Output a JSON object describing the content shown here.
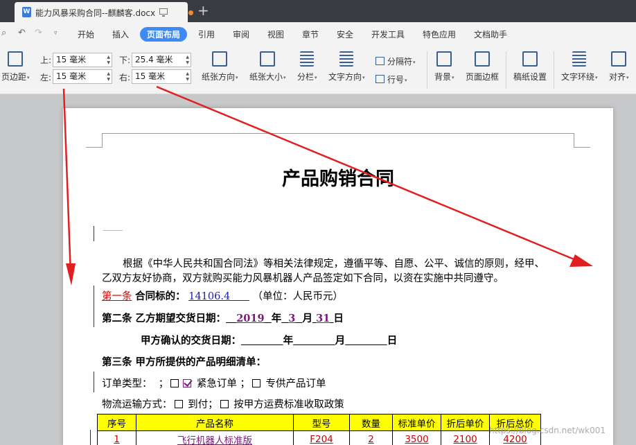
{
  "window": {
    "tab_title": "能力风暴采购合同--麒麟客.docx",
    "doc_icon_label": "W",
    "new_tab_icon": "plus-icon"
  },
  "menu": {
    "icons": [
      "print-preview-icon",
      "undo-icon",
      "redo-icon",
      "dropdown-icon"
    ],
    "items": [
      "开始",
      "插入",
      "页面布局",
      "引用",
      "审阅",
      "视图",
      "章节",
      "安全",
      "开发工具",
      "特色应用",
      "文档助手"
    ],
    "active": "页面布局"
  },
  "ribbon": {
    "margins_button": "页边距",
    "top_label": "上:",
    "top_value": "15 毫米",
    "bottom_label": "下:",
    "bottom_value": "25.4 毫米",
    "left_label": "左:",
    "left_value": "15 毫米",
    "right_label": "右:",
    "right_value": "15 毫米",
    "orientation": "纸张方向",
    "paper_size": "纸张大小",
    "columns": "分栏",
    "text_direction": "文字方向",
    "separator": "分隔符",
    "line_numbers": "行号",
    "background": "背景",
    "page_border": "页面边框",
    "manuscript": "稿纸设置",
    "text_wrap": "文字环绕",
    "align": "对齐"
  },
  "document": {
    "title": "产品购销合同",
    "para1_line1": "根据《中华人民共和国合同法》等相关法律规定，遵循平等、自愿、公平、诚信的原则，经甲、",
    "para1_line2": "乙双方友好协商，双方就购买能力风暴机器人产品签定如下合同，以资在实施中共同遵守。",
    "article1_label": "第一条",
    "article1_text": "合同标的：",
    "article1_amount": "14106.4",
    "article1_unit": "（单位：人民币元）",
    "article2_label": "第二条  乙方期望交货日期：",
    "article2_year": "2019",
    "article2_month": "3",
    "article2_day": "31",
    "year_char": "年",
    "month_char": "月",
    "day_char": "日",
    "confirm_label": "甲方确认的交货日期：",
    "article3": "第三条  甲方所提供的产品明细清单：",
    "order_type_label": "订单类型：",
    "order_type_urgent": "紧急订单",
    "order_type_special": "专供产品订单",
    "logistics_label": "物流运输方式：",
    "logistics_opt1": "到付；",
    "logistics_opt2": "按甲方运费标准收取政策",
    "table": {
      "headers": [
        "序号",
        "产品名称",
        "型号",
        "数量",
        "标准单价",
        "折后单价",
        "折后总价"
      ],
      "rows": [
        [
          "1",
          "飞行机器人标准版",
          "F204",
          "2",
          "3500",
          "2100",
          "4200"
        ]
      ]
    }
  },
  "watermark": "https://blog.csdn.net/wk001",
  "colors": {
    "accent": "#3d8af7",
    "annotation_arrow": "#e02020",
    "table_header": "#ffff00",
    "field_red": "#d20000",
    "field_purple": "#7a1a7a"
  }
}
